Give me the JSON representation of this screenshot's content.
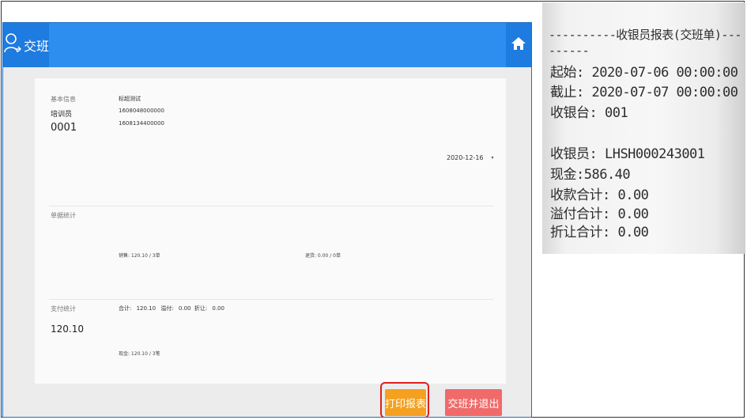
{
  "header": {
    "title": "交班"
  },
  "basic": {
    "label": "基本信息",
    "role": "培训员",
    "id": "0001",
    "store": "标超测试",
    "line1": "1608048000000",
    "line2": "1608134400000",
    "date": "2020-12-16"
  },
  "receipt_stats": {
    "label": "单据统计",
    "sales": "销售: 120.10 / 3单",
    "returns": "退货: 0.00 / 0单"
  },
  "payment": {
    "label": "支付统计",
    "total_label": "合计:",
    "total_value": "120.10",
    "overpay_label": "溢付:",
    "overpay_value": "0.00",
    "discount_label": "折让:",
    "discount_value": "0.00",
    "big_total": "120.10",
    "cash": "现金: 120.10 / 3笔"
  },
  "buttons": {
    "print": "打印报表",
    "shift_exit": "交班并退出"
  },
  "receipt": {
    "header_line": "----------收银员报表(交班单)---",
    "dash_line": "------",
    "start": "起始: 2020-07-06 00:00:00",
    "end": "截止: 2020-07-07 00:00:00",
    "counter": "收银台: 001",
    "cashier": "收银员: LHSH000243001",
    "cash": "现金:586.40",
    "receipt_total": "收款合计: 0.00",
    "overpay_total": "溢付合计: 0.00",
    "discount_total": "折让合计: 0.00"
  }
}
